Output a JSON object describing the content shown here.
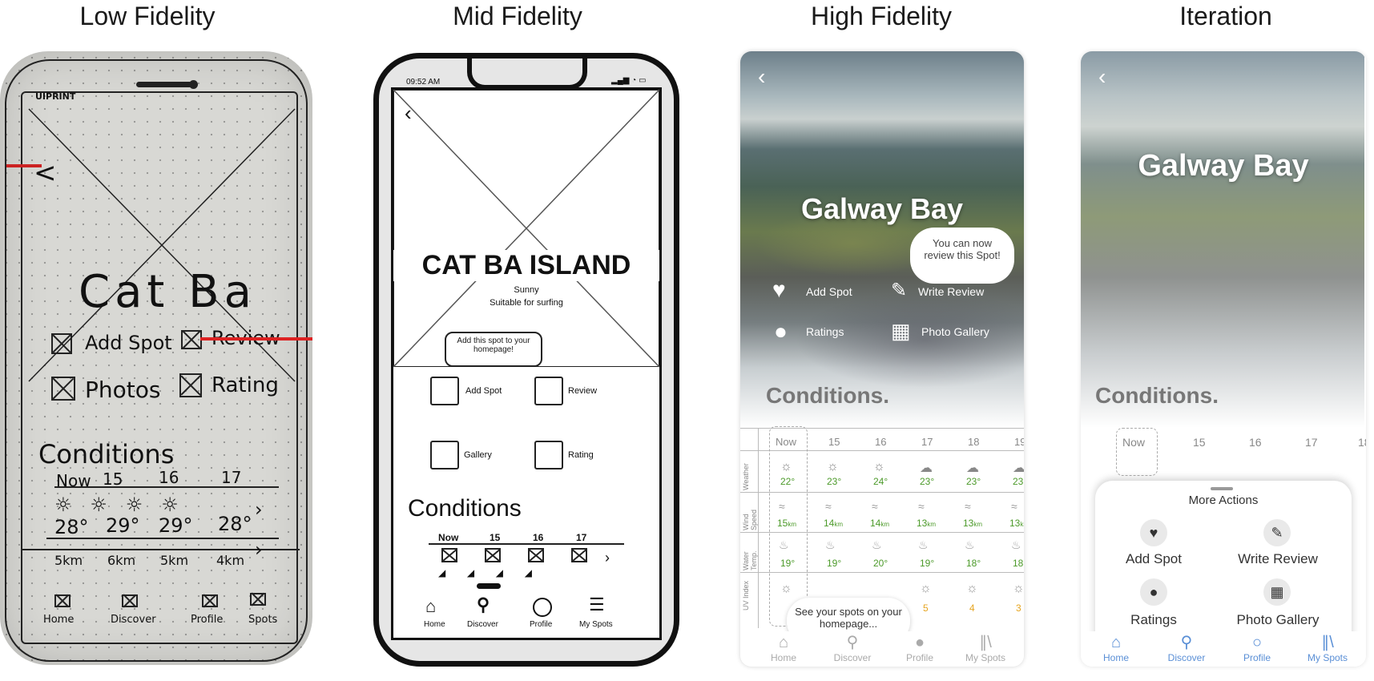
{
  "headings": [
    "Low Fidelity",
    "Mid Fidelity",
    "High Fidelity",
    "Iteration"
  ],
  "low": {
    "brand": "UIPRINT",
    "back": "<",
    "title": "Cat Ba",
    "actions": [
      "Add Spot",
      "Review",
      "Photos",
      "Rating"
    ],
    "conditions": "Conditions",
    "cols": [
      "Now",
      "15",
      "16",
      "17"
    ],
    "temps": [
      "28°",
      "29°",
      "29°",
      "28°"
    ],
    "winds": [
      "5km",
      "6km",
      "5km",
      "4km"
    ],
    "nav": [
      "Home",
      "Discover",
      "Profile",
      "Spots"
    ]
  },
  "mid": {
    "time": "09:52 AM",
    "title": "CAT BA ISLAND",
    "sub1": "Sunny",
    "sub2": "Suitable for surfing",
    "tooltip": "Add this spot to your homepage!",
    "actions": [
      "Add Spot",
      "Review",
      "Gallery",
      "Rating"
    ],
    "conditions": "Conditions",
    "cols": [
      "Now",
      "15",
      "16",
      "17"
    ],
    "nav": [
      "Home",
      "Discover",
      "Profile",
      "My Spots"
    ]
  },
  "high": {
    "title": "Galway Bay",
    "bubble": "You can now review this Spot!",
    "actions": [
      "Add Spot",
      "Write Review",
      "Ratings",
      "Photo Gallery"
    ],
    "conditions": "Conditions.",
    "cols": [
      "Now",
      "15",
      "16",
      "17",
      "18",
      "19"
    ],
    "rows": [
      "Weather",
      "Wind Speed",
      "Water Temp.",
      "UV Index"
    ],
    "air_temps": [
      "22°",
      "23°",
      "24°",
      "23°",
      "23°",
      "23°"
    ],
    "wind": [
      "15",
      "14",
      "14",
      "13",
      "13",
      "13"
    ],
    "wind_unit": "km",
    "water": [
      "19°",
      "19°",
      "20°",
      "19°",
      "18°",
      "18°"
    ],
    "uv": [
      "5",
      "4",
      "3"
    ],
    "toast": "See your spots on your homepage...",
    "nav": [
      "Home",
      "Discover",
      "Profile",
      "My Spots"
    ]
  },
  "iter": {
    "title": "Galway Bay",
    "conditions": "Conditions.",
    "cols": [
      "Now",
      "15",
      "16",
      "17",
      "18"
    ],
    "sheet_title": "More Actions",
    "actions": [
      "Add Spot",
      "Write Review",
      "Ratings",
      "Photo Gallery"
    ],
    "nav": [
      "Home",
      "Discover",
      "Profile",
      "My Spots"
    ],
    "accent": "#5a8fd6"
  }
}
